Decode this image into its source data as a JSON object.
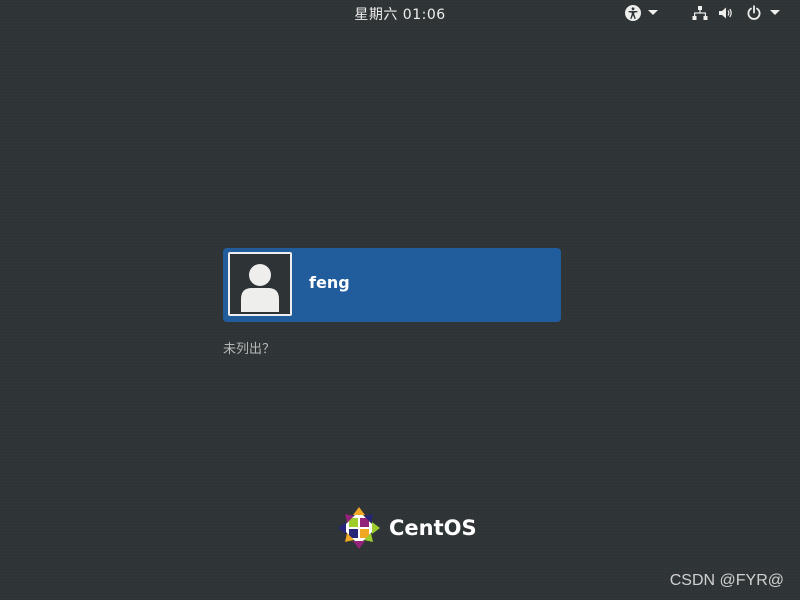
{
  "topbar": {
    "clock": "星期六 01:06",
    "indicators": [
      "accessibility-icon",
      "network-icon",
      "volume-icon",
      "power-icon"
    ]
  },
  "login": {
    "username": "feng",
    "not_listed_label": "未列出？",
    "avatar_icon": "user-avatar-icon"
  },
  "branding": {
    "logo_text": "CentOS",
    "logo_icon": "centos-logo-icon"
  },
  "watermark": "CSDN @FYR@",
  "colors": {
    "background": "#2e3336",
    "selected_user": "#215d9c",
    "text": "#eeeeec",
    "muted_text": "#b5b8b6"
  }
}
